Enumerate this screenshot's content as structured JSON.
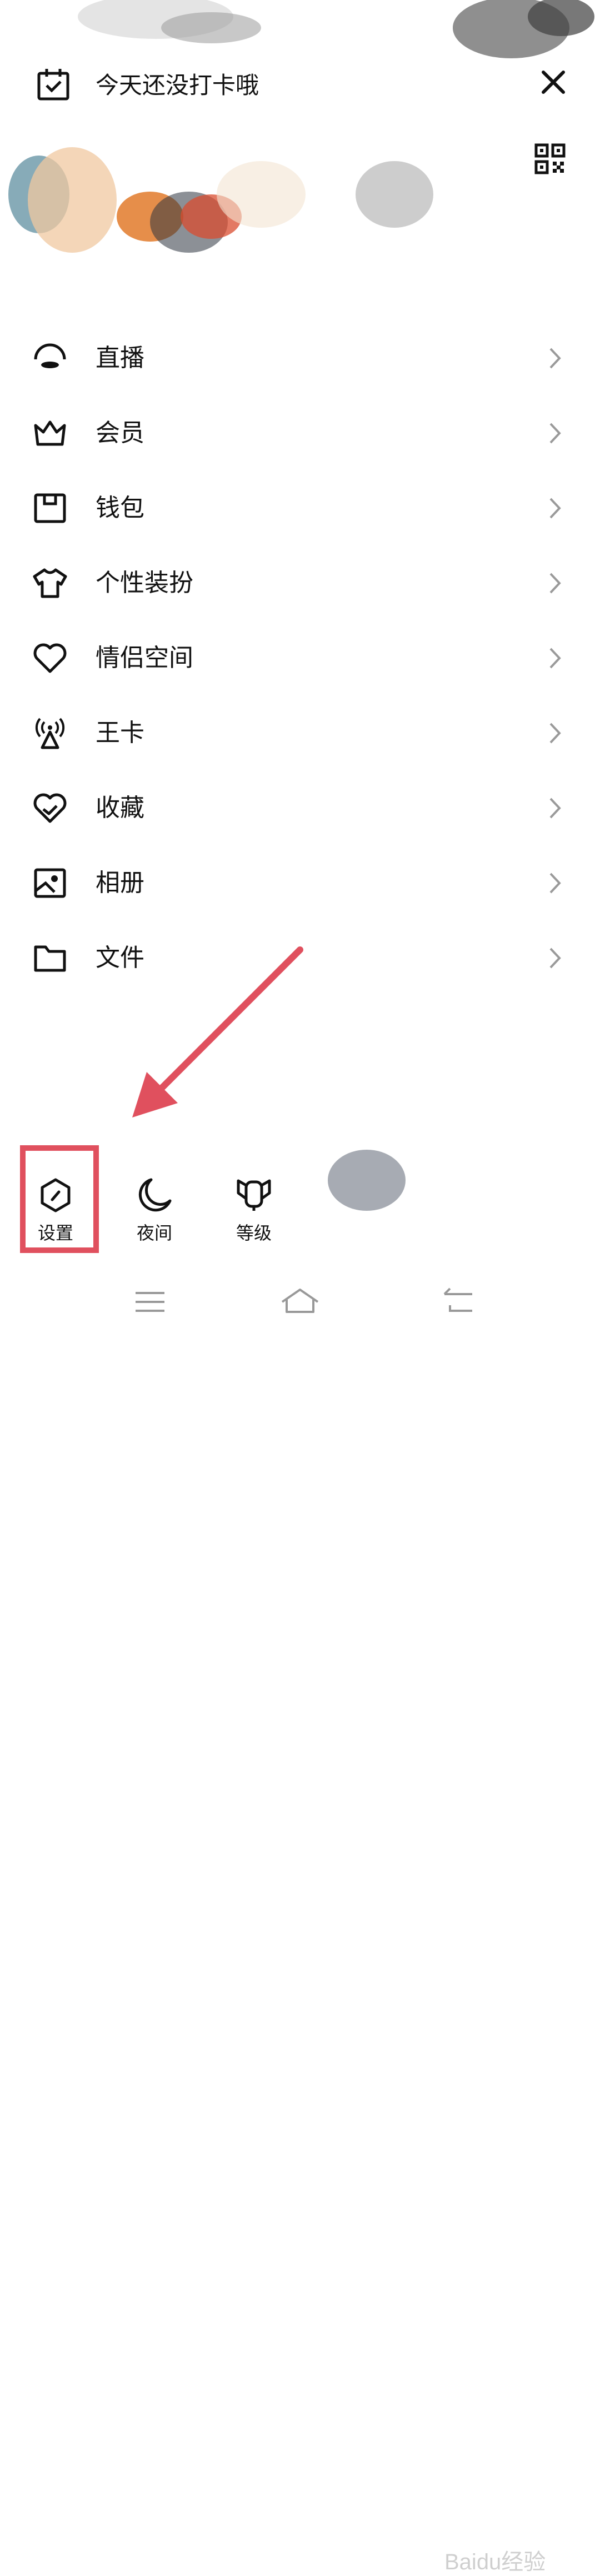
{
  "checkin": {
    "text": "今天还没打卡哦",
    "icon": "calendar-check-icon"
  },
  "header": {
    "close_icon": "close-icon",
    "qr_icon": "qr-code-icon"
  },
  "menu": [
    {
      "label": "直播",
      "icon": "live-icon"
    },
    {
      "label": "会员",
      "icon": "crown-icon"
    },
    {
      "label": "钱包",
      "icon": "wallet-icon"
    },
    {
      "label": "个性装扮",
      "icon": "tshirt-icon"
    },
    {
      "label": "情侣空间",
      "icon": "heart-icon"
    },
    {
      "label": "王卡",
      "icon": "signal-tower-icon"
    },
    {
      "label": "收藏",
      "icon": "favorite-heart-icon"
    },
    {
      "label": "相册",
      "icon": "photo-album-icon"
    },
    {
      "label": "文件",
      "icon": "folder-icon"
    }
  ],
  "bottom_actions": [
    {
      "label": "设置",
      "icon": "settings-hex-icon"
    },
    {
      "label": "夜间",
      "icon": "moon-icon"
    },
    {
      "label": "等级",
      "icon": "level-trophy-icon"
    }
  ],
  "annotation": {
    "highlight_color": "#e0505e",
    "arrow_color": "#e0505e"
  },
  "watermark": "Baidu经验"
}
